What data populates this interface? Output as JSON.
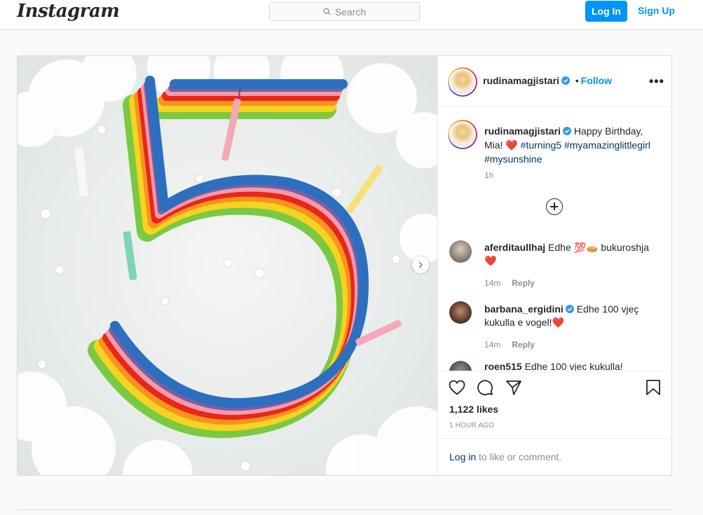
{
  "header": {
    "logo": "Instagram",
    "search_placeholder": "Search",
    "login_label": "Log In",
    "signup_label": "Sign Up"
  },
  "post": {
    "author": "rudinamagjistari",
    "follow_label": "Follow",
    "follow_separator": "•",
    "more_icon": "more-dots-icon",
    "caption": {
      "username": "rudinamagjistari",
      "text": "Happy Birthday, Mia!",
      "heart": "❤️",
      "hashtags": [
        "#turning5",
        "#myamazinglittlegirl",
        "#mysunshine"
      ],
      "time": "1h"
    },
    "comments": [
      {
        "username": "aferditaullhaj",
        "text": "Edhe",
        "emojis": "💯🥧",
        "text2": "bukuroshja",
        "heart": "❤️",
        "time": "14m",
        "reply": "Reply"
      },
      {
        "username": "barbana_ergidini",
        "text": "Edhe 100 vjeç kukulla e vogel!",
        "heart": "❤️",
        "time": "14m",
        "reply": "Reply"
      },
      {
        "username": "roen515",
        "text": "Edhe 100 vjec kukulla!"
      }
    ],
    "likes": "1,122 likes",
    "posted_ago": "1 HOUR AGO",
    "login_prompt": {
      "link": "Log in",
      "rest": "to like or comment."
    }
  },
  "colors": {
    "accent": "#0095f6",
    "verified": "#3897f0",
    "hashtag": "#00376b",
    "heart": "#ed4956"
  }
}
